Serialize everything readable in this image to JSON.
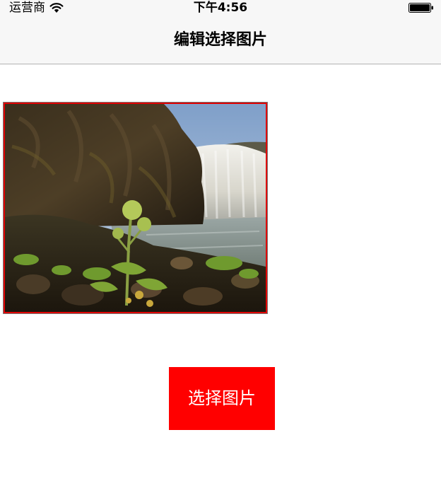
{
  "status_bar": {
    "carrier": "运营商",
    "time": "下午4:56",
    "wifi_icon": "wifi-icon",
    "battery_icon": "battery-icon"
  },
  "nav_bar": {
    "title": "编辑选择图片"
  },
  "photo": {
    "description_icon": "waterfall-photo",
    "border_color": "#e00000"
  },
  "select_button": {
    "label": "选择图片",
    "color": "#ff0000",
    "text_color": "#ffffff"
  }
}
